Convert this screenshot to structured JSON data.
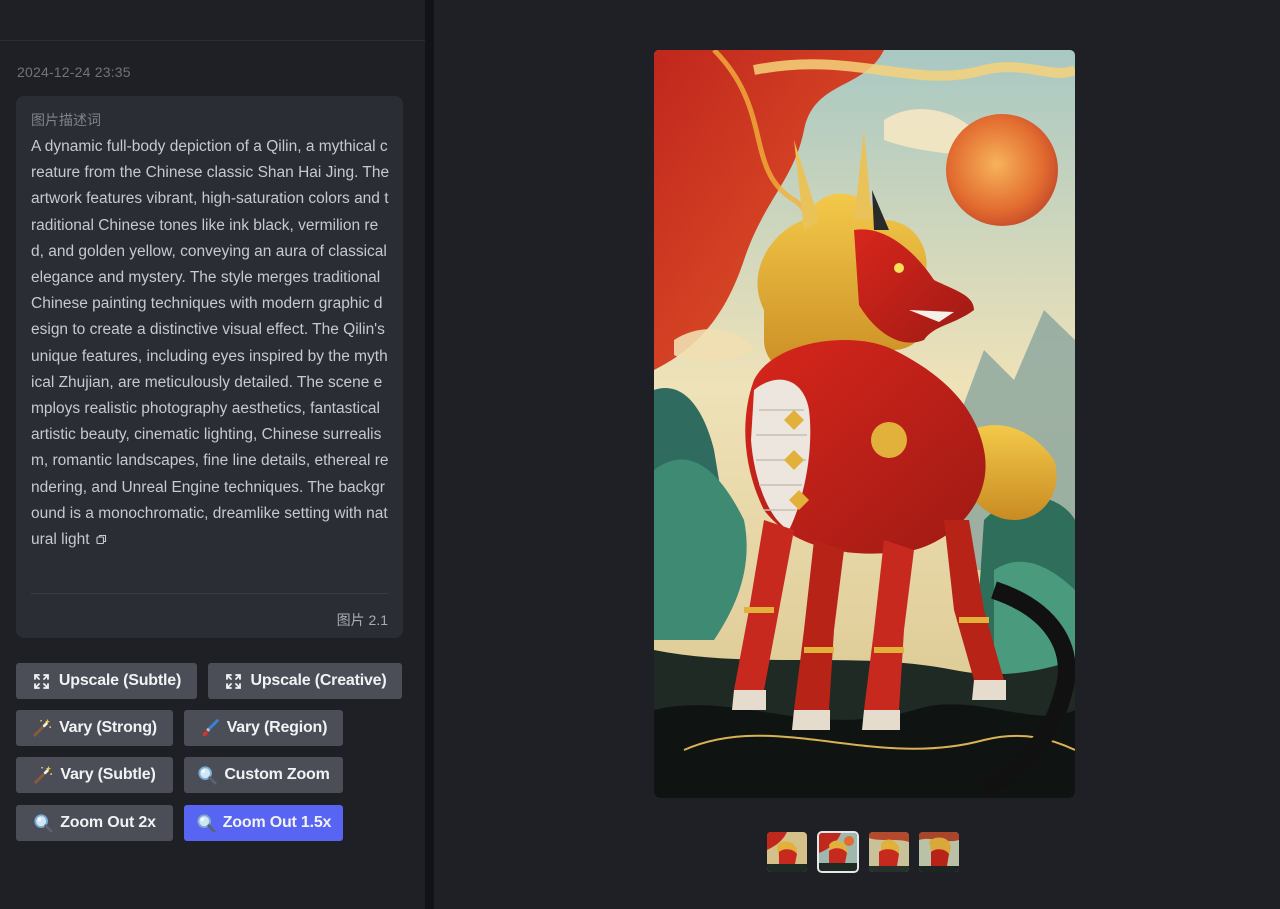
{
  "timestamp": "2024-12-24 23:35",
  "prompt": {
    "heading": "图片描述词",
    "text": "A dynamic full-body depiction of a Qilin, a mythical creature from the Chinese classic Shan Hai Jing. The artwork features vibrant, high-saturation colors and traditional Chinese tones like ink black, vermilion red, and golden yellow, conveying an aura of classical elegance and mystery. The style merges traditional Chinese painting techniques with modern graphic design to create a distinctive visual effect. The Qilin's unique features, including eyes inspired by the mythical Zhujian, are meticulously detailed. The scene employs realistic photography aesthetics, fantastical artistic beauty, cinematic lighting, Chinese surrealism, romantic landscapes, fine line details, ethereal rendering, and Unreal Engine techniques. The background is a monochromatic, dreamlike setting with natural light",
    "image_label": "图片 2.1"
  },
  "buttons": {
    "upscale_subtle": "Upscale (Subtle)",
    "upscale_creative": "Upscale (Creative)",
    "vary_strong": "Vary (Strong)",
    "vary_region": "Vary (Region)",
    "vary_subtle": "Vary (Subtle)",
    "custom_zoom": "Custom Zoom",
    "zoom_out_2x": "Zoom Out 2x",
    "zoom_out_1_5x": "Zoom Out 1.5x"
  },
  "icons": {
    "upscale": "expand-arrows-icon",
    "vary": "magic-wand-icon",
    "region": "paintbrush-icon",
    "zoom": "magnifier-icon",
    "copy": "copy-icon"
  },
  "thumbnails": {
    "count": 4,
    "active_index": 1
  },
  "colors": {
    "accent": "#5865f2",
    "button": "#4b4e57",
    "panel": "#1e2026",
    "card": "#2a2d34"
  }
}
